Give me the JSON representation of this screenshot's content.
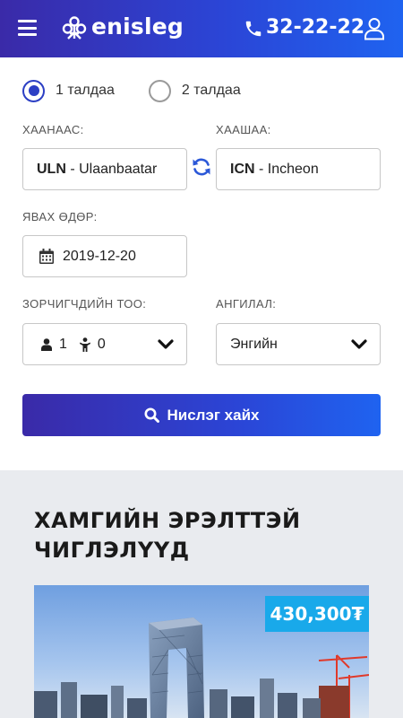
{
  "header": {
    "brand": "enisleg",
    "phone": "32-22-22",
    "icons": [
      "menu-icon",
      "logo-icon",
      "phone-icon",
      "user-icon"
    ]
  },
  "trip_type": {
    "options": [
      {
        "label": "1 талдаа",
        "selected": true
      },
      {
        "label": "2 талдаа",
        "selected": false
      }
    ]
  },
  "search_form": {
    "from_label": "ХААНААС:",
    "from_code": "ULN",
    "from_city": " - Ulaanbaatar",
    "to_label": "ХААШАА:",
    "to_code": "ICN",
    "to_city": " - Incheon",
    "date_label": "ЯВАХ ӨДӨР:",
    "date_value": "2019-12-20",
    "passengers_label": "ЗОРЧИГЧДИЙН ТОО:",
    "adults": "1",
    "children": "0",
    "class_label": "АНГИЛАЛ:",
    "class_value": "Энгийн",
    "search_button": "Нислэг хайх"
  },
  "popular": {
    "title_line1": "ХАМГИЙН ЭРЭЛТТЭЙ",
    "title_line2": "ЧИГЛЭЛҮҮД",
    "cards": [
      {
        "price": "430,300₮"
      }
    ]
  },
  "colors": {
    "brand_gradient_start": "#3a2aa8",
    "brand_gradient_end": "#1f63f0",
    "accent": "#2c3fc4",
    "price_badge": "#19a9ea",
    "section_bg": "#e9ebef"
  }
}
